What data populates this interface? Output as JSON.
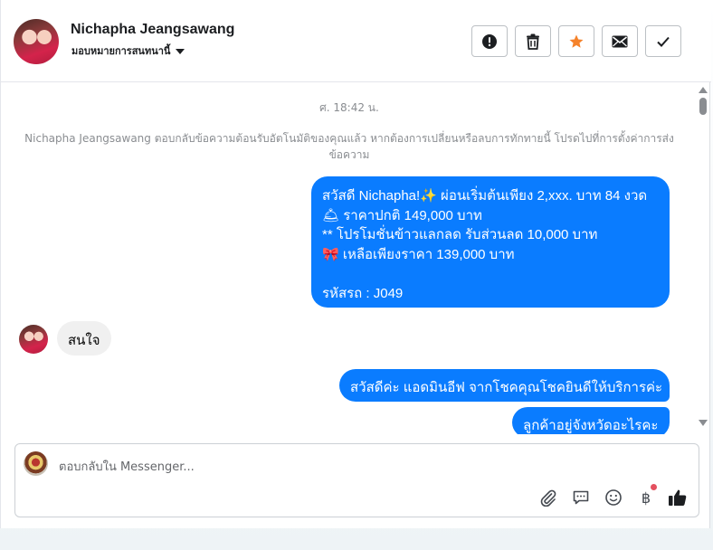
{
  "header": {
    "name": "Nichapha Jeangsawang",
    "assign_label": "มอบหมายการสนทนานี้",
    "actions": [
      "mark-spam",
      "delete",
      "star",
      "mark-unread",
      "mark-done"
    ]
  },
  "conversation": {
    "timestamp": "ศ. 18:42 น.",
    "system_message": "Nichapha Jeangsawang ตอบกลับข้อความต้อนรับอัตโนมัติของคุณแล้ว หากต้องการเปลี่ยนหรือลบการทักทายนี้ โปรดไปที่การตั้งค่าการส่งข้อความ",
    "outgoing_1": {
      "line1": "สวัสดี Nichapha!✨  ผ่อนเริ่มต้นเพียง 2,xxx. บาท 84 งวด",
      "line2": "🛎 ราคาปกติ 149,000 บาท",
      "line3": "** โปรโมชั่นข้าวแลกลด รับส่วนลด 10,000 บาท",
      "line4": "🎀  เหลือเพียงราคา 139,000 บาท",
      "line5": "",
      "line6": " รหัสรถ : J049"
    },
    "incoming_1": "สนใจ",
    "outgoing_2": "สวัสดีค่ะ แอดมินอีฟ จากโชคคุณโชคยินดีให้บริการค่ะ",
    "outgoing_3": "ลูกค้าอยู่จังหวัดอะไรคะ"
  },
  "composer": {
    "placeholder": "ตอบกลับใน Messenger...",
    "baht_symbol": "฿",
    "icons": [
      "attachment-icon",
      "saved-reply-icon",
      "emoji-icon",
      "payment-icon",
      "thumbs-up-icon"
    ]
  },
  "colors": {
    "outgoing_bubble": "#0a7cff",
    "incoming_bubble": "#f0f0f0",
    "star_accent": "#f5822a"
  }
}
